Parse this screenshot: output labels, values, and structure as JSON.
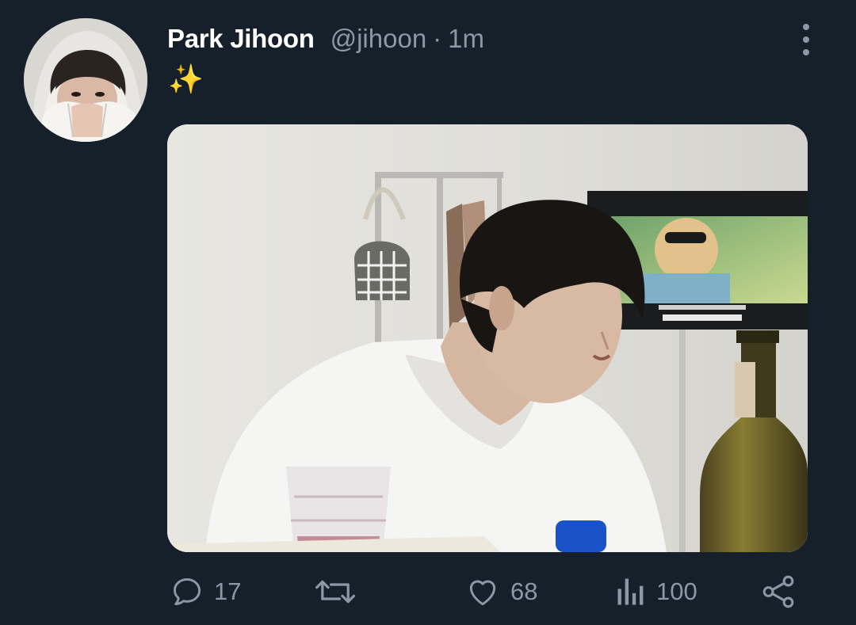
{
  "tweet": {
    "display_name": "Park Jihoon",
    "handle": "@jihoon",
    "separator": "·",
    "time": "1m",
    "text": "✨"
  },
  "actions": {
    "reply_count": "17",
    "retweet_count": "",
    "like_count": "68",
    "views_count": "100"
  },
  "colors": {
    "background": "#15202b",
    "secondary_text": "#8b98a5",
    "primary_text": "#ffffff"
  },
  "icons": {
    "reply": "speech-bubble-icon",
    "retweet": "retweet-icon",
    "like": "heart-icon",
    "views": "bar-chart-icon",
    "share": "share-icon",
    "more": "vertical-dots-icon"
  }
}
